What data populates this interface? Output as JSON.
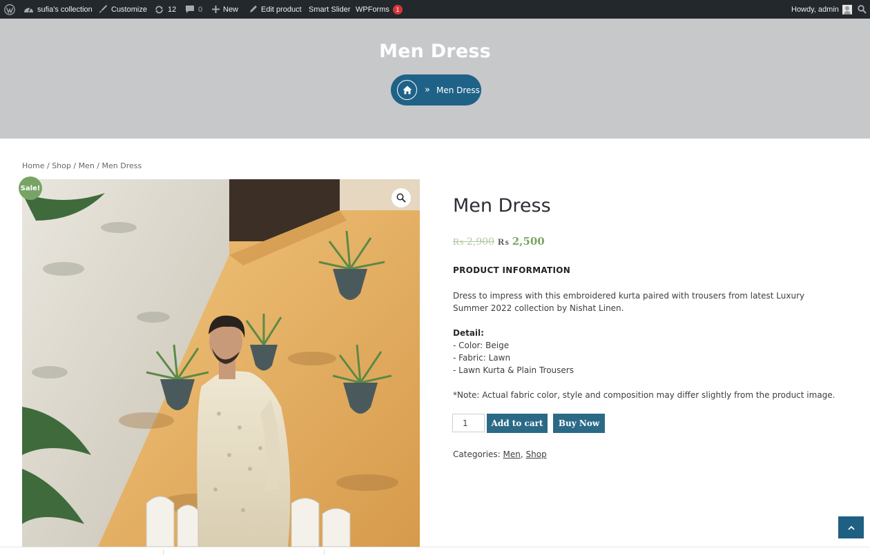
{
  "adminbar": {
    "site_name": "sufia's collection",
    "customize": "Customize",
    "updates_count": "12",
    "comments_count": "0",
    "new_label": "New",
    "edit_label": "Edit product",
    "smart_slider": "Smart Slider",
    "wpforms": "WPForms",
    "wpforms_badge": "1",
    "howdy": "Howdy, admin"
  },
  "banner": {
    "title": "Men Dress",
    "separator": "»",
    "current": "Men Dress"
  },
  "breadcrumb": {
    "home": "Home",
    "shop": "Shop",
    "men": "Men",
    "current": "Men Dress",
    "sep": " / "
  },
  "product": {
    "sale_badge": "Sale!",
    "title": "Men Dress",
    "old_price": "₨ 2,900",
    "currency": "₨",
    "new_price": "2,500",
    "info_heading": "PRODUCT INFORMATION",
    "description": "Dress to impress with this embroidered kurta paired with trousers from latest Luxury Summer 2022 collection by Nishat Linen.",
    "detail_heading": "Detail:",
    "details": [
      "- Color: Beige",
      "- Fabric: Lawn",
      "- Lawn Kurta & Plain Trousers"
    ],
    "note": "*Note: Actual fabric color, style and composition may differ slightly from the product image.",
    "quantity": "1",
    "add_to_cart": "Add to cart",
    "buy_now": "Buy Now",
    "categories_label": "Categories: ",
    "categories": [
      "Men",
      "Shop"
    ],
    "categories_sep": ", "
  },
  "colors": {
    "adminbar": "#23282d",
    "banner": "#c7c8ca",
    "accent": "#1f6287",
    "sale": "#77a464"
  }
}
